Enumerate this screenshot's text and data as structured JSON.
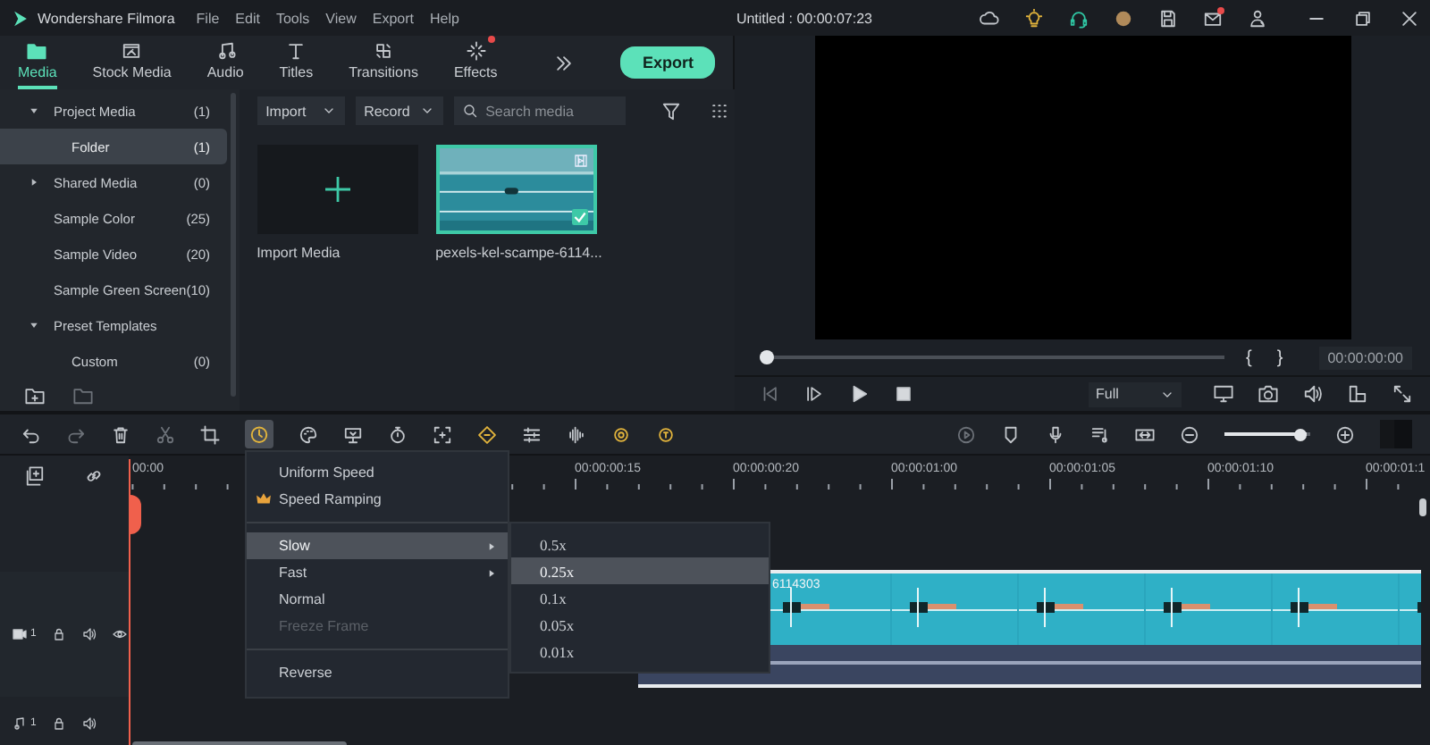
{
  "app": {
    "name": "Wondershare Filmora"
  },
  "menu": [
    {
      "label": "File"
    },
    {
      "label": "Edit"
    },
    {
      "label": "Tools"
    },
    {
      "label": "View"
    },
    {
      "label": "Export"
    },
    {
      "label": "Help"
    }
  ],
  "window": {
    "title": "Untitled : 00:00:07:23"
  },
  "tabs": [
    {
      "label": "Media",
      "selected": true,
      "badge": false
    },
    {
      "label": "Stock Media",
      "selected": false,
      "badge": false
    },
    {
      "label": "Audio",
      "selected": false,
      "badge": false
    },
    {
      "label": "Titles",
      "selected": false,
      "badge": false
    },
    {
      "label": "Transitions",
      "selected": false,
      "badge": false
    },
    {
      "label": "Effects",
      "selected": false,
      "badge": true
    }
  ],
  "export_button": "Export",
  "sidebar": {
    "items": [
      {
        "kind": "group",
        "label": "Project Media",
        "count": "(1)",
        "expanded": true,
        "selected": false,
        "children": [
          {
            "label": "Folder",
            "count": "(1)",
            "selected": true
          }
        ]
      },
      {
        "kind": "group",
        "label": "Shared Media",
        "count": "(0)",
        "expanded": false,
        "selected": false
      },
      {
        "kind": "item",
        "label": "Sample Color",
        "count": "(25)",
        "selected": false
      },
      {
        "kind": "item",
        "label": "Sample Video",
        "count": "(20)",
        "selected": false
      },
      {
        "kind": "item",
        "label": "Sample Green Screen",
        "count": "(10)",
        "selected": false
      },
      {
        "kind": "group",
        "label": "Preset Templates",
        "expanded": true,
        "selected": false,
        "children": [
          {
            "label": "Custom",
            "count": "(0)",
            "selected": false
          }
        ]
      }
    ]
  },
  "media_toolbar": {
    "import": "Import",
    "record": "Record",
    "search": {
      "placeholder": "Search media"
    }
  },
  "media": [
    {
      "kind": "import",
      "label": "Import Media"
    },
    {
      "kind": "clip",
      "label": "pexels-kel-scampe-6114...",
      "selected": true
    }
  ],
  "preview": {
    "level": 0,
    "mark_in": "{",
    "mark_out": "}",
    "timecode": "00:00:00:00",
    "quality": "Full"
  },
  "zoom": {
    "level": 0.95
  },
  "ruler": [
    "00:00",
    "00:00:00:15",
    "00:00:00:20",
    "00:00:01:00",
    "00:00:01:05",
    "00:00:01:10",
    "00:00:01:1"
  ],
  "speed_menu": [
    {
      "kind": "item",
      "label": "Uniform Speed",
      "selected": false,
      "disabled": false
    },
    {
      "kind": "premium",
      "label": "Speed Ramping",
      "selected": false,
      "disabled": false
    },
    {
      "kind": "separator"
    },
    {
      "kind": "submenu",
      "label": "Slow",
      "selected": true,
      "disabled": false
    },
    {
      "kind": "submenu",
      "label": "Fast",
      "selected": false,
      "disabled": false
    },
    {
      "kind": "item",
      "label": "Normal",
      "selected": false,
      "disabled": false
    },
    {
      "kind": "item",
      "label": "Freeze Frame",
      "selected": false,
      "disabled": true
    },
    {
      "kind": "separator"
    },
    {
      "kind": "item",
      "label": "Reverse",
      "selected": false,
      "disabled": false
    }
  ],
  "speed_submenu": [
    {
      "label": "0.5x",
      "selected": false
    },
    {
      "label": "0.25x",
      "selected": true
    },
    {
      "label": "0.1x",
      "selected": false
    },
    {
      "label": "0.05x",
      "selected": false
    },
    {
      "label": "0.01x",
      "selected": false
    }
  ],
  "tracks": [
    {
      "kind": "video",
      "number": "1"
    },
    {
      "kind": "audio",
      "number": "1"
    }
  ],
  "clip": {
    "label": "6114303"
  }
}
